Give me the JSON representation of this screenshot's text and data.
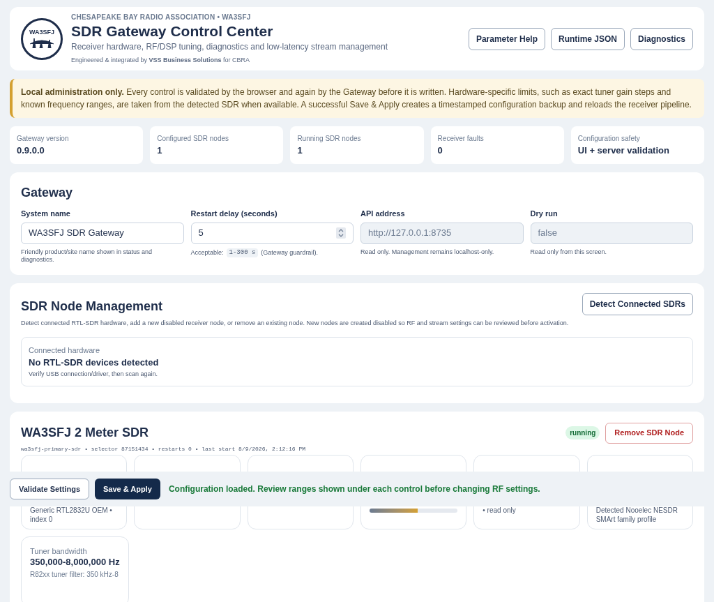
{
  "header": {
    "logo_text": "WA3SFJ",
    "org": "CHESAPEAKE BAY RADIO ASSOCIATION • WA3SFJ",
    "title": "SDR Gateway Control Center",
    "subtitle": "Receiver hardware, RF/DSP tuning, diagnostics and low-latency stream management",
    "credit": "Engineered & integrated by **VSS Business Solutions** for CBRA",
    "buttons": [
      "Parameter Help",
      "Runtime JSON",
      "Diagnostics"
    ]
  },
  "notice": "**Local administration only.** Every control is validated by the browser and again by the Gateway before it is written. Hardware-specific limits, such as exact tuner gain steps and known frequency ranges, are taken from the detected SDR when available. A successful Save & Apply creates a timestamped configuration backup and reloads the receiver pipeline.",
  "stats": [
    {
      "label": "Gateway version",
      "value": "0.9.0.0"
    },
    {
      "label": "Configured SDR nodes",
      "value": "1"
    },
    {
      "label": "Running SDR nodes",
      "value": "1"
    },
    {
      "label": "Receiver faults",
      "value": "0"
    },
    {
      "label": "Configuration safety",
      "value": "UI + server validation"
    }
  ],
  "gateway": {
    "title": "Gateway",
    "fields": [
      {
        "label": "System name",
        "value": "WA3SFJ SDR Gateway",
        "disabled": false,
        "kind": "text",
        "help": "Friendly product/site name shown in status and diagnostics."
      },
      {
        "label": "Restart delay (seconds)",
        "value": "5",
        "disabled": false,
        "kind": "number",
        "help_before": "Acceptable:",
        "help_code": "1-300 s",
        "help_after": "(Gateway guardrail)."
      },
      {
        "label": "API address",
        "value": "http://127.0.0.1:8735",
        "disabled": true,
        "kind": "text",
        "help": "Read only. Management remains localhost-only."
      },
      {
        "label": "Dry run",
        "value": "false",
        "disabled": true,
        "kind": "text",
        "help": "Read only from this screen."
      }
    ]
  },
  "node_management": {
    "title": "SDR Node Management",
    "button": "Detect Connected SDRs",
    "description": "Detect connected RTL-SDR hardware, add a new disabled receiver node, or remove an existing node. New nodes are created disabled so RF and stream settings can be reviewed before activation.",
    "hardware": {
      "label": "Connected hardware",
      "value": "No RTL-SDR devices detected",
      "help": "Verify USB connection/driver, then scan again."
    }
  },
  "node": {
    "title": "WA3SFJ 2 Meter SDR",
    "status": "running",
    "remove_button": "Remove SDR Node",
    "meta": "wa3sfj-primary-sdr • selector 87151434 • restarts 0 • last start 8/9/2026, 2:12:16 PM",
    "cards": [
      {
        "kind": "text",
        "note": "Generic RTL2832U OEM • index 0"
      },
      {
        "kind": "empty"
      },
      {
        "kind": "empty"
      },
      {
        "kind": "meter",
        "level": 0.55
      },
      {
        "kind": "text",
        "note": "• read only"
      },
      {
        "kind": "text",
        "note": "Detected Nooelec NESDR SMArt family profile"
      },
      {
        "kind": "full",
        "label": "Tuner bandwidth",
        "value": "350,000-8,000,000 Hz",
        "note": "R82xx tuner filter: 350 kHz-8"
      }
    ]
  },
  "action_bar": {
    "buttons": [
      "Validate Settings",
      "Save & Apply"
    ],
    "message": "Configuration loaded. Review ranges shown under each control before changing RF settings."
  }
}
